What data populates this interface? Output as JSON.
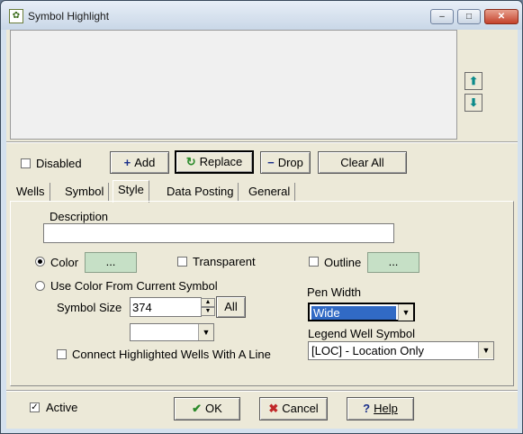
{
  "window": {
    "title": "Symbol Highlight",
    "controls": {
      "minimize": "–",
      "maximize": "□",
      "close": "✕"
    }
  },
  "list": {
    "up_icon": "arrow-up-icon",
    "down_icon": "arrow-down-icon"
  },
  "toolbar": {
    "disabled_label": "Disabled",
    "add_label": "Add",
    "replace_label": "Replace",
    "drop_label": "Drop",
    "clear_all_label": "Clear All"
  },
  "tabs": [
    {
      "label": "Wells"
    },
    {
      "label": "Symbol"
    },
    {
      "label": "Style"
    },
    {
      "label": "Data Posting"
    },
    {
      "label": "General"
    }
  ],
  "style": {
    "description_label": "Description",
    "description_value": "",
    "color_label": "Color",
    "color_button": "...",
    "transparent_label": "Transparent",
    "outline_label": "Outline",
    "outline_button": "...",
    "use_current_label": "Use Color From Current Symbol",
    "symbol_size_label": "Symbol Size",
    "symbol_size_value": "374",
    "all_label": "All",
    "pen_width_label": "Pen Width",
    "pen_width_value": "Wide",
    "legend_label": "Legend Well Symbol",
    "legend_value": "[LOC] - Location Only",
    "connect_label": "Connect Highlighted Wells With A Line",
    "swatch_color": "#c6e0c6"
  },
  "footer": {
    "active_label": "Active",
    "ok_label": "OK",
    "cancel_label": "Cancel",
    "help_label": "Help"
  }
}
